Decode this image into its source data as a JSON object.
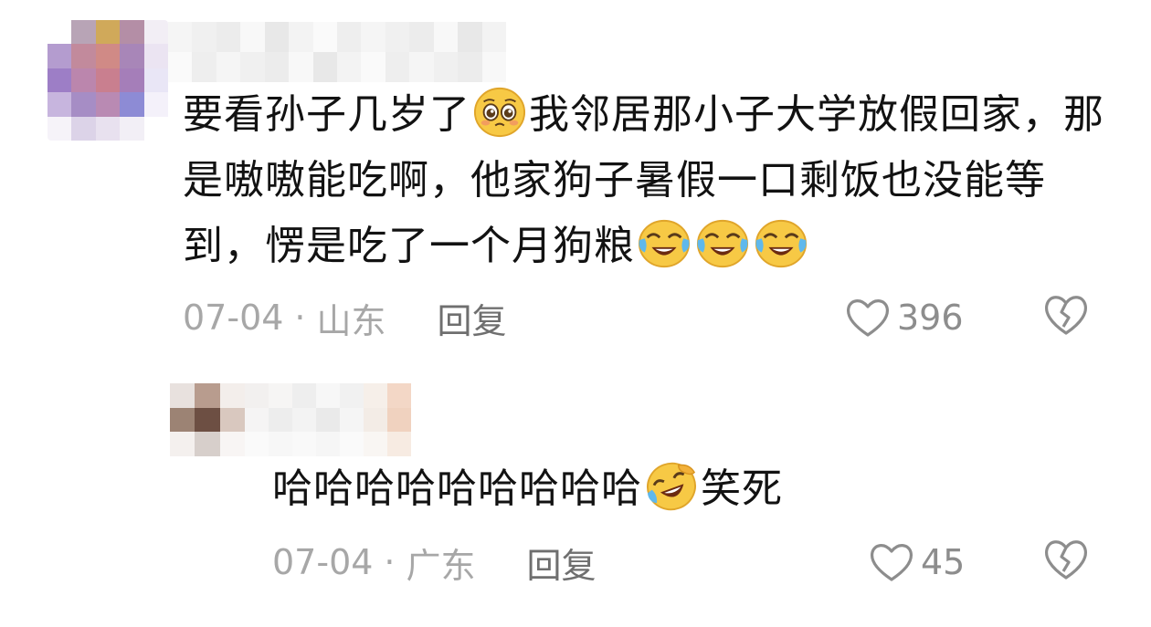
{
  "comments": [
    {
      "text_segments": [
        "要看孙子几岁了",
        "我邻居那小子大学放假回家，那是嗷嗷能吃啊，他家狗子暑假一口剩饭也没能等到，愣是吃了一个月狗粮"
      ],
      "emoji_after_first": "pleading-face-emoji",
      "trailing_emojis": [
        "crying-laughing-emoji",
        "crying-laughing-emoji",
        "crying-laughing-emoji"
      ],
      "date": "07-04",
      "separator": "·",
      "location": "山东",
      "reply_label": "回复",
      "like_count": "396"
    },
    {
      "text_segments": [
        "哈哈哈哈哈哈哈哈哈",
        "笑死"
      ],
      "emoji_after_first": "rolling-laughing-emoji",
      "date": "07-04",
      "separator": "·",
      "location": "广东",
      "reply_label": "回复",
      "like_count": "45"
    }
  ],
  "colors": {
    "text": "#121212",
    "meta": "#a7a7a7",
    "reply": "#6f6f6f",
    "icon": "#8d8d8d"
  }
}
